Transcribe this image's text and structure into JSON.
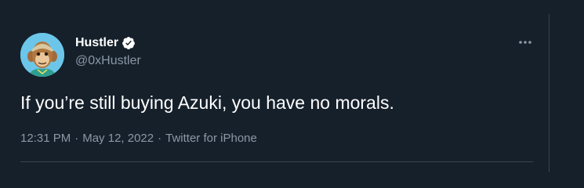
{
  "tweet": {
    "display_name": "Hustler",
    "handle": "@0xHustler",
    "verified": true,
    "text": "If you’re still buying Azuki, you have no morals.",
    "time": "12:31 PM",
    "separator": "·",
    "date": "May 12, 2022",
    "source": "Twitter for iPhone"
  },
  "icons": {
    "avatar": "ape-avatar",
    "verified": "verified-badge-icon",
    "more": "more-options-icon"
  },
  "colors": {
    "background": "#15202b",
    "text_primary": "#ffffff",
    "text_secondary": "#8b98a5",
    "divider": "#38444d",
    "avatar_bg": "#6cc6e9"
  }
}
